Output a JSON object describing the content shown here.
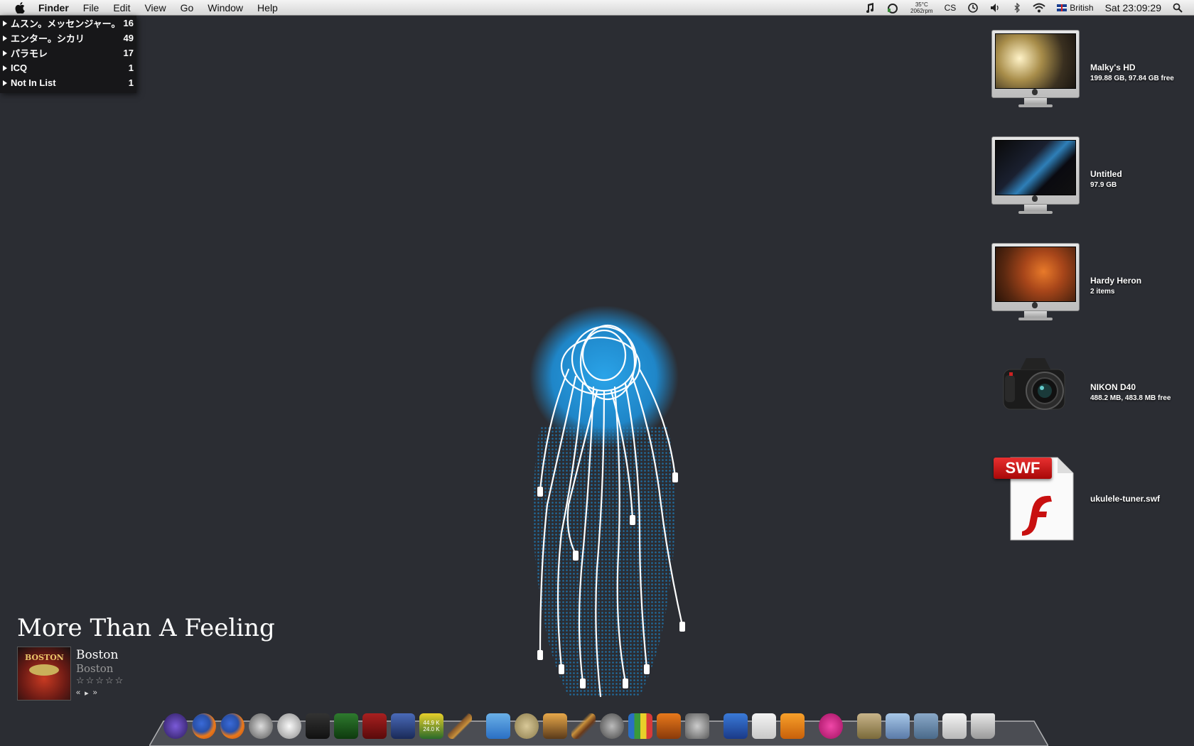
{
  "menubar": {
    "app_name": "Finder",
    "items": [
      "File",
      "Edit",
      "View",
      "Go",
      "Window",
      "Help"
    ],
    "status": {
      "temperature": "35°C",
      "fan": "2062rpm",
      "cs_label": "CS",
      "input_source": "British",
      "clock": "Sat 23:09:29"
    }
  },
  "buddy_list": {
    "groups": [
      {
        "name": "ムスン。メッセンジャー。",
        "count": "16"
      },
      {
        "name": "エンター。シカリ",
        "count": "49"
      },
      {
        "name": "パラモレ",
        "count": "17"
      },
      {
        "name": "ICQ",
        "count": "1"
      },
      {
        "name": "Not In List",
        "count": "1"
      }
    ]
  },
  "desktop": {
    "icons": [
      {
        "name": "Malky's HD",
        "sub": "199.88 GB, 97.84 GB free"
      },
      {
        "name": "Untitled",
        "sub": "97.9 GB"
      },
      {
        "name": "Hardy Heron",
        "sub": "2 items"
      },
      {
        "name": "NIKON D40",
        "sub": "488.2 MB, 483.8 MB free"
      },
      {
        "name": "ukulele-tuner.swf",
        "sub": ""
      }
    ],
    "swf_badge": "SWF"
  },
  "now_playing": {
    "title": "More Than A Feeling",
    "artist": "Boston",
    "album": "Boston",
    "rating": "☆☆☆☆☆",
    "art_text": "BOSTON",
    "controls": {
      "prev": "«",
      "play": "▸",
      "next": "»"
    }
  },
  "dock": {
    "net_up": "44.9 K",
    "net_down": "24.0 K",
    "icons": [
      "launcher-icon",
      "firefox-icon",
      "firefox-icon",
      "itunes-icon",
      "safari-icon",
      "robot-icon",
      "lighthouse-icon",
      "book-icon",
      "monitor-icon",
      "activity-monitor-icon",
      "guitar-icon",
      "mail-icon",
      "safari-hat-icon",
      "iphoto-icon",
      "garageband-icon",
      "finder-icon",
      "charts-icon",
      "keynote-icon",
      "system-preferences-icon",
      "photoshop-icon",
      "acrobat-icon",
      "illustrator-icon",
      "music-player-icon",
      "folder-icon",
      "folder-icon",
      "folder-icon",
      "window-icon",
      "trash-icon"
    ],
    "colors": {
      "blue": "#2a6fc4",
      "orange": "#e8791b",
      "pink": "#d8338a",
      "gray": "#8e8e8e",
      "brown": "#8a5a2b"
    }
  }
}
